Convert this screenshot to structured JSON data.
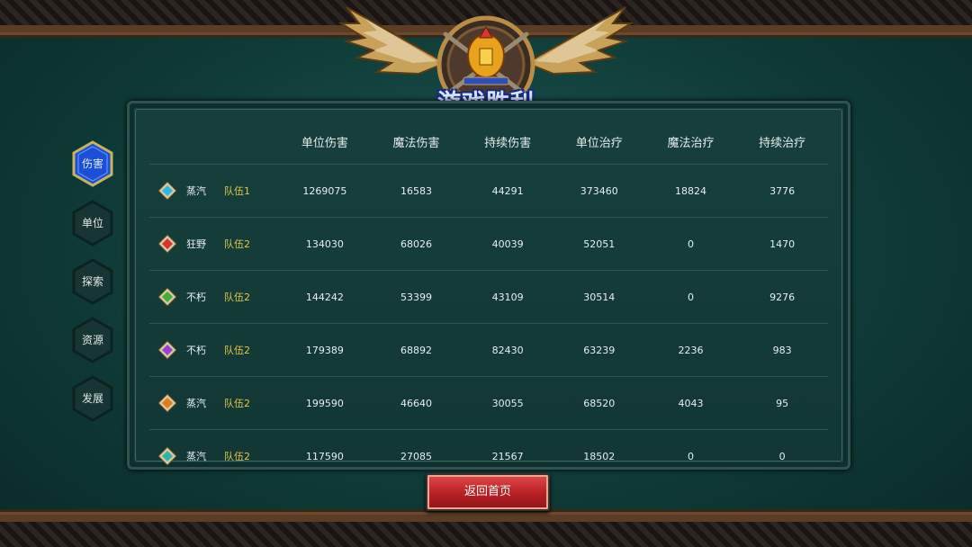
{
  "header": {
    "title": "游戏胜利"
  },
  "sidebar": {
    "items": [
      {
        "label": "伤害",
        "active": true
      },
      {
        "label": "单位",
        "active": false
      },
      {
        "label": "探索",
        "active": false
      },
      {
        "label": "资源",
        "active": false
      },
      {
        "label": "发展",
        "active": false
      }
    ]
  },
  "table": {
    "columns": [
      "单位伤害",
      "魔法伤害",
      "持续伤害",
      "单位治疗",
      "魔法治疗",
      "持续治疗"
    ],
    "rows": [
      {
        "gem_color": "#2fb8e6",
        "name": "蒸汽",
        "team": "队伍1",
        "values": [
          "1269075",
          "16583",
          "44291",
          "373460",
          "18824",
          "3776"
        ]
      },
      {
        "gem_color": "#d8342c",
        "name": "狂野",
        "team": "队伍2",
        "values": [
          "134030",
          "68026",
          "40039",
          "52051",
          "0",
          "1470"
        ]
      },
      {
        "gem_color": "#3fae3a",
        "name": "不朽",
        "team": "队伍2",
        "values": [
          "144242",
          "53399",
          "43109",
          "30514",
          "0",
          "9276"
        ]
      },
      {
        "gem_color": "#9a3fd0",
        "name": "不朽",
        "team": "队伍2",
        "values": [
          "179389",
          "68892",
          "82430",
          "63239",
          "2236",
          "983"
        ]
      },
      {
        "gem_color": "#e07a1e",
        "name": "蒸汽",
        "team": "队伍2",
        "values": [
          "199590",
          "46640",
          "30055",
          "68520",
          "4043",
          "95"
        ]
      },
      {
        "gem_color": "#33b3a8",
        "name": "蒸汽",
        "team": "队伍2",
        "values": [
          "117590",
          "27085",
          "21567",
          "18502",
          "0",
          "0"
        ]
      }
    ]
  },
  "footer": {
    "return_label": "返回首页"
  },
  "colors": {
    "team_label": "#e2c64a",
    "active_tab": "#1f5fe0",
    "return_button": "#c0262b"
  }
}
